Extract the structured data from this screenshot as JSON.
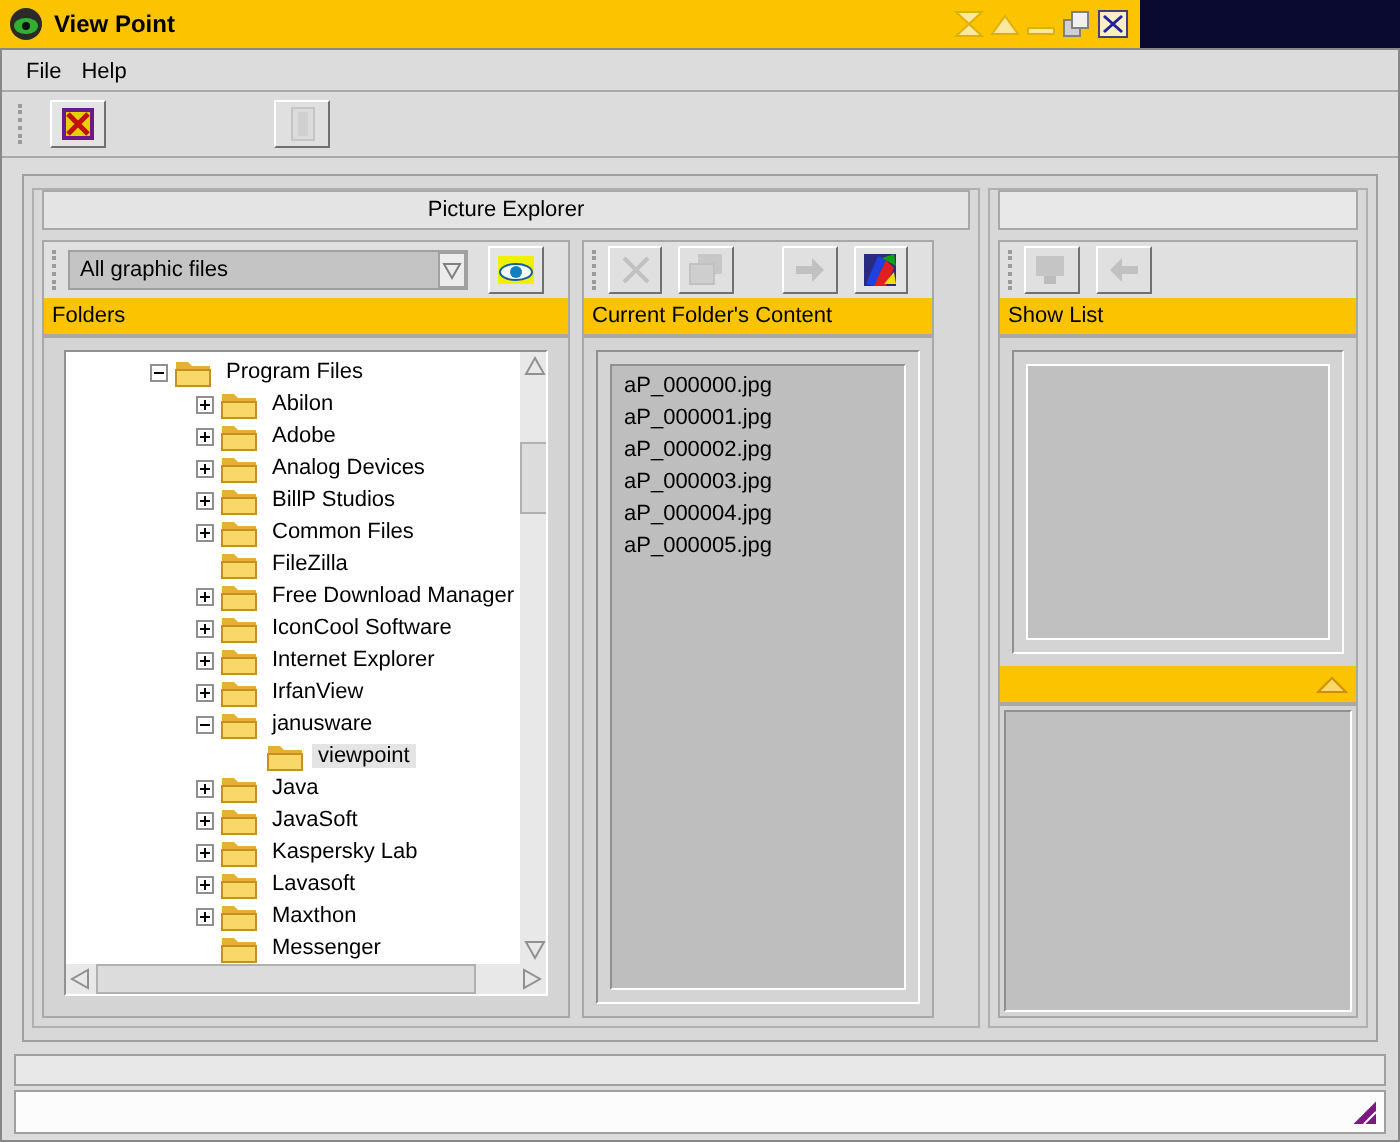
{
  "window": {
    "title": "View Point"
  },
  "menu": [
    "File",
    "Help"
  ],
  "toolbar": [
    {
      "kind": "close-x",
      "disabled": false
    },
    {
      "kind": "door",
      "disabled": true
    }
  ],
  "explorer": {
    "title": "Picture Explorer",
    "filter": {
      "value": "All graphic files"
    },
    "folders": {
      "title": "Folders",
      "tree": [
        {
          "label": "Program Files",
          "expandable": true,
          "expanded": true,
          "selected": false,
          "children": [
            {
              "label": "Abilon",
              "expandable": true,
              "expanded": false,
              "selected": false
            },
            {
              "label": "Adobe",
              "expandable": true,
              "expanded": false,
              "selected": false
            },
            {
              "label": "Analog Devices",
              "expandable": true,
              "expanded": false,
              "selected": false
            },
            {
              "label": "BillP Studios",
              "expandable": true,
              "expanded": false,
              "selected": false
            },
            {
              "label": "Common Files",
              "expandable": true,
              "expanded": false,
              "selected": false
            },
            {
              "label": "FileZilla",
              "expandable": false,
              "selected": false
            },
            {
              "label": "Free Download Manager",
              "expandable": true,
              "expanded": false,
              "selected": false
            },
            {
              "label": "IconCool Software",
              "expandable": true,
              "expanded": false,
              "selected": false
            },
            {
              "label": "Internet Explorer",
              "expandable": true,
              "expanded": false,
              "selected": false
            },
            {
              "label": "IrfanView",
              "expandable": true,
              "expanded": false,
              "selected": false
            },
            {
              "label": "janusware",
              "expandable": true,
              "expanded": true,
              "selected": false,
              "children": [
                {
                  "label": "viewpoint",
                  "expandable": false,
                  "selected": true
                }
              ]
            },
            {
              "label": "Java",
              "expandable": true,
              "expanded": false,
              "selected": false
            },
            {
              "label": "JavaSoft",
              "expandable": true,
              "expanded": false,
              "selected": false
            },
            {
              "label": "Kaspersky Lab",
              "expandable": true,
              "expanded": false,
              "selected": false
            },
            {
              "label": "Lavasoft",
              "expandable": true,
              "expanded": false,
              "selected": false
            },
            {
              "label": "Maxthon",
              "expandable": true,
              "expanded": false,
              "selected": false
            },
            {
              "label": "Messenger",
              "expandable": false,
              "selected": false
            }
          ]
        }
      ]
    },
    "content": {
      "title": "Current Folder's Content",
      "tools": [
        {
          "kind": "delete",
          "disabled": true
        },
        {
          "kind": "copy",
          "disabled": true
        },
        {
          "kind": "move",
          "disabled": true
        },
        {
          "kind": "colors",
          "disabled": false
        }
      ],
      "files": [
        "aP_000000.jpg",
        "aP_000001.jpg",
        "aP_000002.jpg",
        "aP_000003.jpg",
        "aP_000004.jpg",
        "aP_000005.jpg"
      ]
    }
  },
  "show_list": {
    "title": "Show List",
    "tools": [
      {
        "kind": "slideshow",
        "disabled": true
      },
      {
        "kind": "back",
        "disabled": true
      }
    ]
  }
}
